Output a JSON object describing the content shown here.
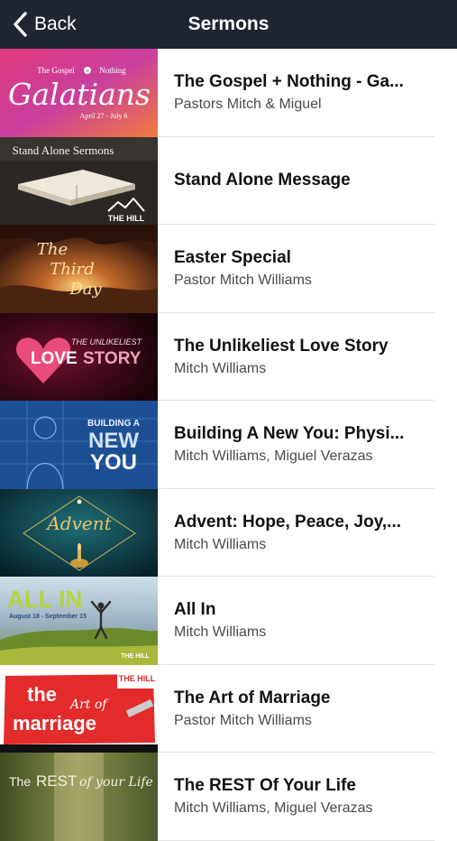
{
  "nav": {
    "back_label": "Back",
    "title": "Sermons"
  },
  "thumbs": {
    "t1": {
      "top": "The Gospel",
      "plus": "+",
      "nothing": "Nothing",
      "script": "Galatians",
      "dates": "April 27 - July 6"
    },
    "t2": {
      "banner": "Stand Alone Sermons",
      "logo": "THE HILL"
    },
    "t3": {
      "line1": "The",
      "line2": "Third",
      "line3": "Day"
    },
    "t4": {
      "small": "THE UNLIKELIEST",
      "love": "LOVE",
      "story": "STORY"
    },
    "t5": {
      "line1": "BUILDING A",
      "line2": "NEW",
      "line3": "YOU"
    },
    "t6": {
      "script": "Advent"
    },
    "t7": {
      "big": "ALL IN",
      "dates": "August 18 - September 15",
      "logo": "THE HILL"
    },
    "t8": {
      "the": "the",
      "art": "Art of",
      "marriage": "marriage",
      "logo": "THE HILL"
    },
    "t9": {
      "text1": "The",
      "text2": "REST",
      "text3": "of your Life"
    }
  },
  "sermons": [
    {
      "title": "The Gospel + Nothing - Ga...",
      "subtitle": "Pastors Mitch & Miguel"
    },
    {
      "title": "Stand Alone Message",
      "subtitle": ""
    },
    {
      "title": "Easter Special",
      "subtitle": "Pastor Mitch Williams"
    },
    {
      "title": "The Unlikeliest Love Story",
      "subtitle": "Mitch Williams"
    },
    {
      "title": "Building A New You: Physi...",
      "subtitle": "Mitch Williams, Miguel Verazas"
    },
    {
      "title": "Advent: Hope, Peace, Joy,...",
      "subtitle": "Mitch Williams"
    },
    {
      "title": "All In",
      "subtitle": "Mitch Williams"
    },
    {
      "title": "The Art of Marriage",
      "subtitle": "Pastor Mitch Williams"
    },
    {
      "title": "The REST Of Your Life",
      "subtitle": "Mitch Williams, Miguel Verazas"
    }
  ]
}
